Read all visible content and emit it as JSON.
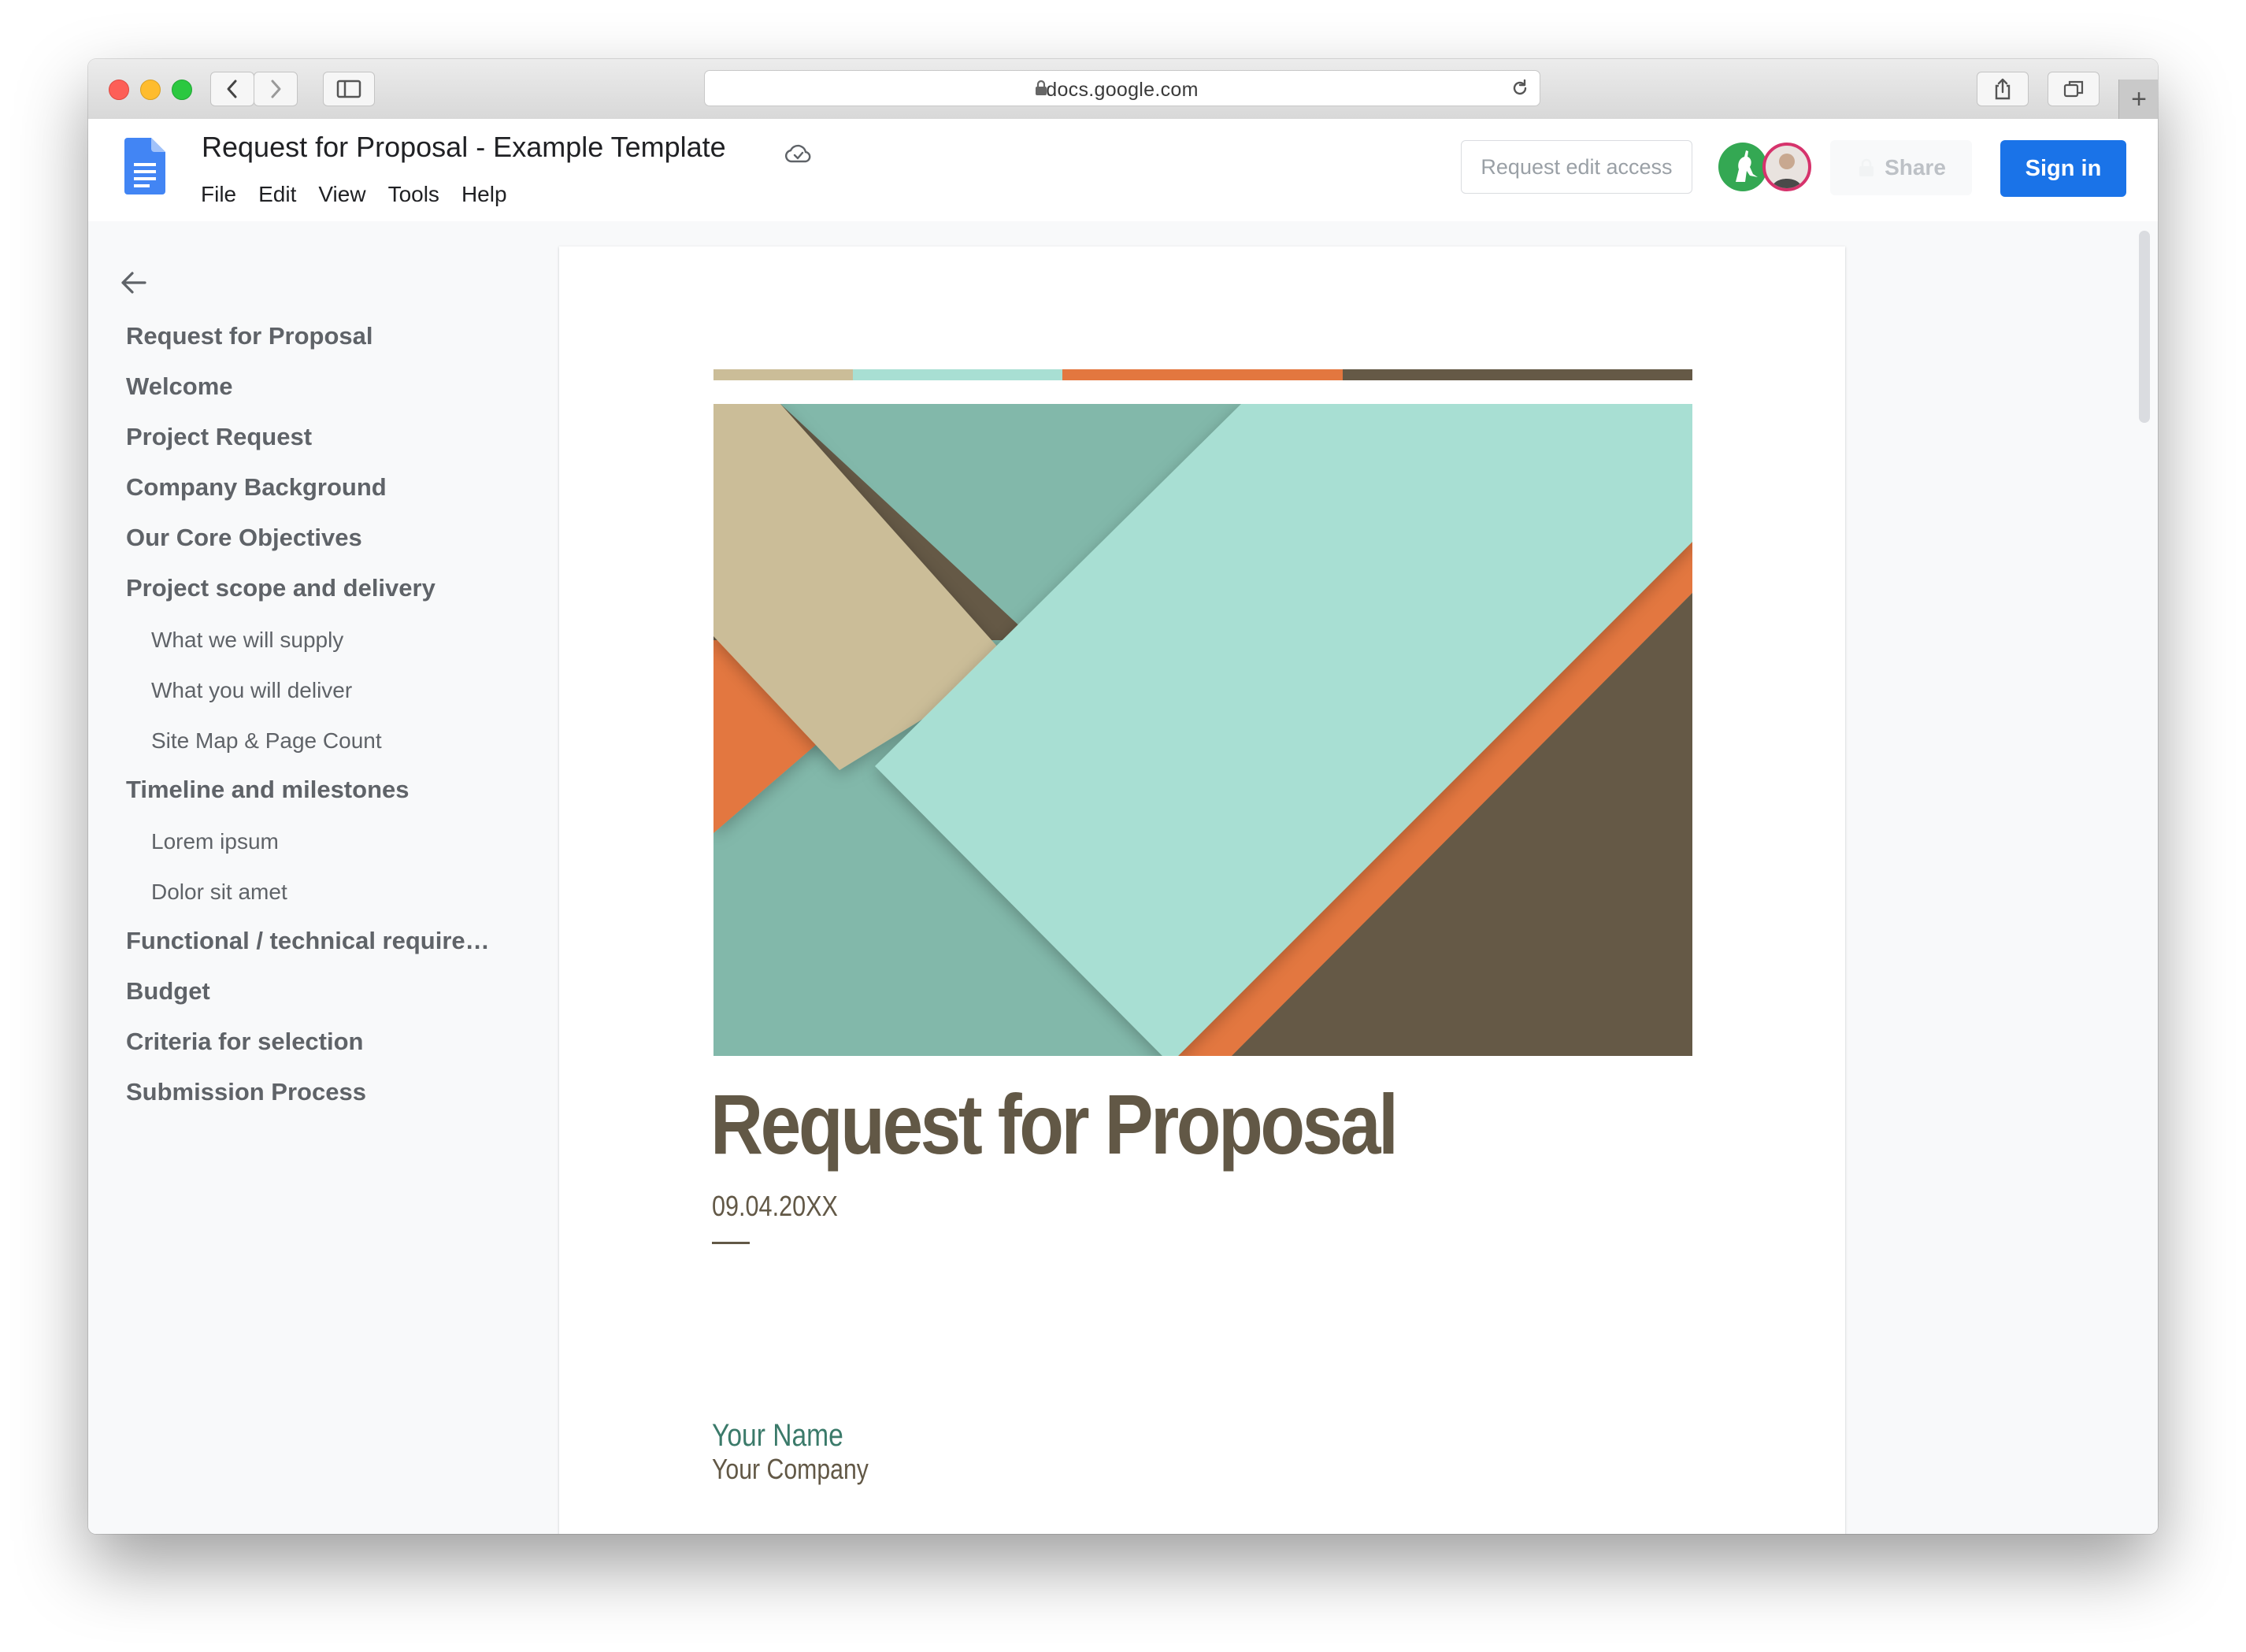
{
  "browser": {
    "url": "docs.google.com",
    "new_tab_symbol": "+"
  },
  "docs": {
    "title": "Request for Proposal - Example Template",
    "menu": [
      "File",
      "Edit",
      "View",
      "Tools",
      "Help"
    ],
    "request_edit_label": "Request edit access",
    "share_label": "Share",
    "signin_label": "Sign in",
    "accent_color": "#1a73e8"
  },
  "outline": {
    "items": [
      {
        "label": "Request for Proposal",
        "level": 1
      },
      {
        "label": "Welcome",
        "level": 1
      },
      {
        "label": "Project Request",
        "level": 1
      },
      {
        "label": "Company Background",
        "level": 1
      },
      {
        "label": "Our Core Objectives",
        "level": 1
      },
      {
        "label": "Project scope and delivery",
        "level": 1
      },
      {
        "label": "What we will supply",
        "level": 2
      },
      {
        "label": "What you will deliver",
        "level": 2
      },
      {
        "label": "Site Map & Page Count",
        "level": 2
      },
      {
        "label": "Timeline and milestones",
        "level": 1
      },
      {
        "label": "Lorem ipsum",
        "level": 2
      },
      {
        "label": "Dolor sit amet",
        "level": 2
      },
      {
        "label": "Functional / technical require…",
        "level": 1
      },
      {
        "label": "Budget",
        "level": 1
      },
      {
        "label": "Criteria for selection",
        "level": 1
      },
      {
        "label": "Submission Process",
        "level": 1
      }
    ]
  },
  "document": {
    "heading": "Request for Proposal",
    "date": "09.04.20XX",
    "name": "Your Name",
    "company": "Your Company",
    "palette": {
      "tan": "#cbbd98",
      "mint": "#a8dfd3",
      "teal": "#82b8aa",
      "orange": "#e3773f",
      "brown": "#655946"
    }
  }
}
